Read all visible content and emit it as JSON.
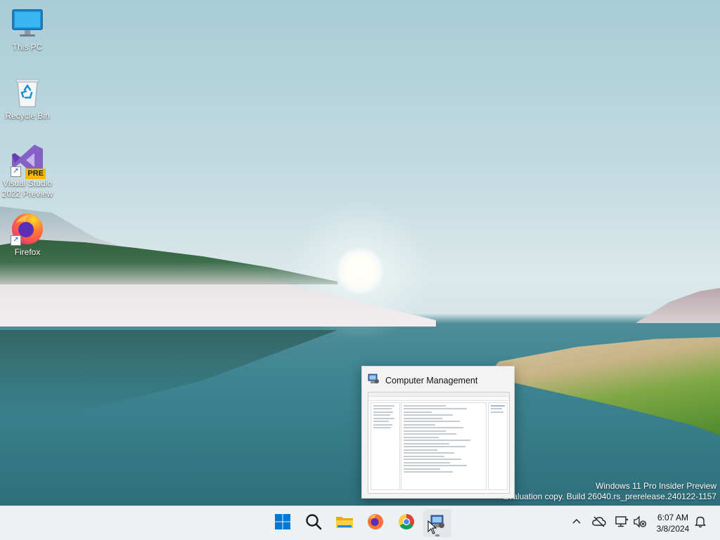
{
  "desktop_icons": [
    {
      "label": "This PC",
      "icon": "monitor-icon"
    },
    {
      "label": "Recycle Bin",
      "icon": "recycle-bin-icon"
    },
    {
      "label": "Visual Studio 2022 Preview",
      "icon": "visual-studio-preview-icon",
      "badge": "PRE"
    },
    {
      "label": "Firefox",
      "icon": "firefox-icon"
    }
  ],
  "watermark": {
    "line1": "Windows 11 Pro Insider Preview",
    "line2": "Evaluation copy. Build 26040.rs_prerelease.240122-1157"
  },
  "taskbar_preview": {
    "title": "Computer Management",
    "icon": "computer-management-icon"
  },
  "taskbar": {
    "apps": [
      {
        "name": "start",
        "icon": "windows-start-icon"
      },
      {
        "name": "search",
        "icon": "search-icon"
      },
      {
        "name": "file-explorer",
        "icon": "folder-icon"
      },
      {
        "name": "firefox",
        "icon": "firefox-icon"
      },
      {
        "name": "chrome",
        "icon": "chrome-icon"
      },
      {
        "name": "computer-management",
        "icon": "computer-management-icon",
        "active": true
      }
    ],
    "tray": {
      "icons": [
        "chevron-up-icon",
        "cloud-offline-icon",
        "network-icon",
        "volume-muted-icon"
      ],
      "time": "6:07 AM",
      "date": "3/8/2024",
      "notification_icon": "bell-icon"
    }
  },
  "colors": {
    "accent_blue": "#0078d4",
    "taskbar_bg": "#eef1f4"
  }
}
